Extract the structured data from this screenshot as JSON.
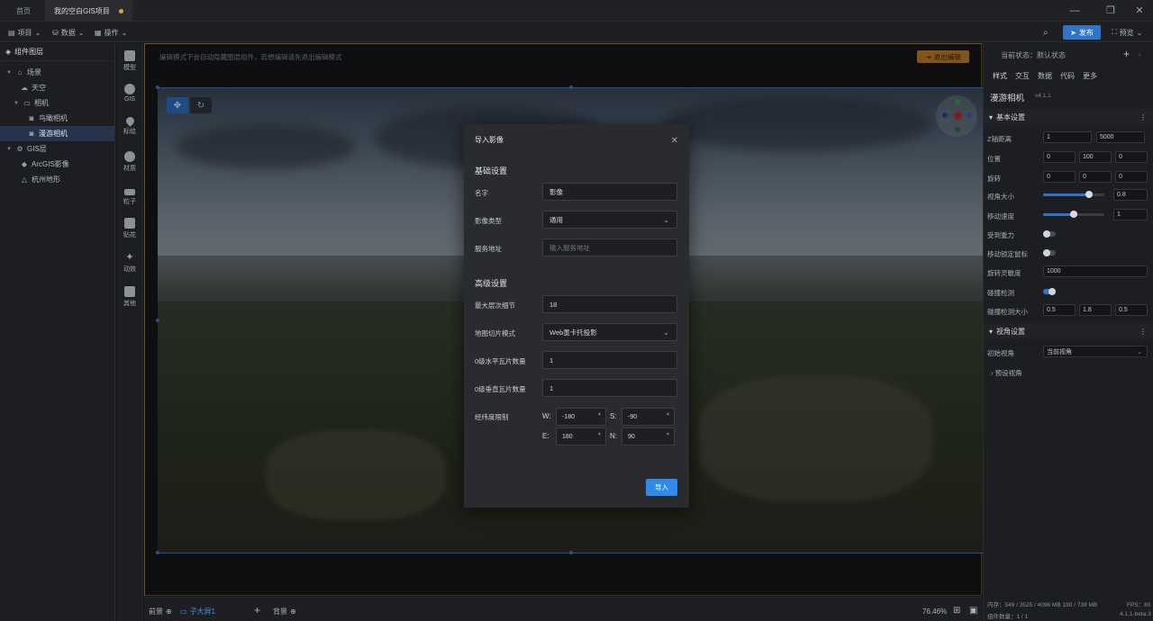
{
  "tabs": [
    {
      "label": "首页"
    },
    {
      "label": "我的空白GIS项目",
      "modified": true
    }
  ],
  "toolbar": {
    "project_label": "项目",
    "data_label": "数据",
    "ops_label": "操作",
    "publish_label": "发布",
    "preview_label": "预览"
  },
  "layers": {
    "title": "组件图层",
    "items": [
      {
        "label": "场景"
      },
      {
        "label": "天空"
      },
      {
        "label": "相机"
      },
      {
        "label": "鸟瞰相机"
      },
      {
        "label": "漫游相机"
      },
      {
        "label": "GIS层"
      },
      {
        "label": "ArcGIS影像"
      },
      {
        "label": "杭州地形"
      }
    ]
  },
  "components": [
    "模型",
    "GIS",
    "标绘",
    "材质",
    "粒子",
    "贴花",
    "动效",
    "其他"
  ],
  "canvas": {
    "notice": "编辑模式下会自动隐藏图层组件，若想编辑请先退出编辑模式",
    "exit_edit": "退出编辑"
  },
  "bottom": {
    "left_tab": "前景",
    "active_scene": "子大屏1",
    "right_tab": "背景",
    "zoom": "76.46%"
  },
  "right_panel": {
    "state_label": "当前状态：默认状态",
    "tabs": [
      "样式",
      "交互",
      "数据",
      "代码",
      "更多"
    ],
    "component_name": "漫游相机",
    "version": "v4.1.1",
    "basic_section": "基本设置",
    "fields": {
      "z_dist_label": "Z轴距离",
      "z_min": "1",
      "z_max": "5000",
      "position_label": "位置",
      "pos": [
        "0",
        "100",
        "0"
      ],
      "rotation_label": "旋转",
      "rot": [
        "0",
        "0",
        "0"
      ],
      "fov_label": "视角大小",
      "fov_value": "0.8",
      "fov_level": 0.75,
      "speed_label": "移动速度",
      "speed_value": "1",
      "speed_level": 0.5,
      "gravity_label": "受到重力",
      "lock_mouse_label": "移动锁定鼠标",
      "sensitivity_label": "旋转灵敏度",
      "sensitivity_value": "1000",
      "collision_label": "碰撞检测",
      "collision_size_label": "碰撞检测大小",
      "collision_size": [
        "0.5",
        "1.8",
        "0.5"
      ]
    },
    "view_section": "视角设置",
    "init_view_label": "初始视角",
    "init_view_value": "当前视角",
    "preset_view": "预设视角",
    "memory": "内存：549 / 3525 / 4096 MB  190 / 739 MB",
    "fps": "FPS：60",
    "comp_count": "组件数量：1 / 1",
    "build": "4.1.1-beta.3"
  },
  "modal": {
    "title": "导入影像",
    "basic_section": "基础设置",
    "name_label": "名字",
    "name_value": "影像",
    "type_label": "影像类型",
    "type_value": "通用",
    "url_label": "服务地址",
    "url_placeholder": "输入服务地址",
    "advanced_section": "高级设置",
    "max_level_label": "最大层次细节",
    "max_level_value": "18",
    "tiling_label": "地图切片模式",
    "tiling_value": "Web墨卡托投影",
    "h_tiles_label": "0级水平瓦片数量",
    "h_tiles_value": "1",
    "v_tiles_label": "0级垂直瓦片数量",
    "v_tiles_value": "1",
    "bounds_label": "经纬度限制",
    "w_label": "W:",
    "w_value": "-180",
    "s_label": "S:",
    "s_value": "-90",
    "e_label": "E:",
    "e_value": "180",
    "n_label": "N:",
    "n_value": "90",
    "import_label": "导入"
  }
}
